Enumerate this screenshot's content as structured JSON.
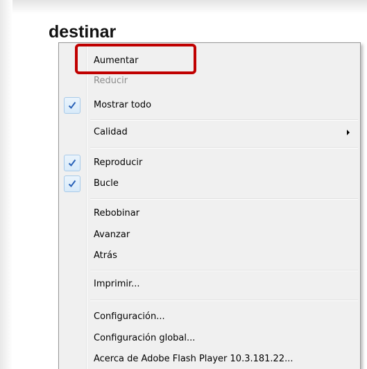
{
  "page": {
    "heading": "destinar"
  },
  "context_menu": {
    "items": [
      {
        "label": "Aumentar",
        "enabled": true,
        "checked": false,
        "submenu": false
      },
      {
        "label": "Reducir",
        "enabled": false,
        "checked": false,
        "submenu": false
      },
      {
        "label": "Mostrar todo",
        "enabled": true,
        "checked": true,
        "submenu": false
      },
      {
        "label": "Calidad",
        "enabled": true,
        "checked": false,
        "submenu": true
      },
      {
        "label": "Reproducir",
        "enabled": true,
        "checked": true,
        "submenu": false
      },
      {
        "label": "Bucle",
        "enabled": true,
        "checked": true,
        "submenu": false
      },
      {
        "label": "Rebobinar",
        "enabled": true,
        "checked": false,
        "submenu": false
      },
      {
        "label": "Avanzar",
        "enabled": true,
        "checked": false,
        "submenu": false
      },
      {
        "label": "Atrás",
        "enabled": true,
        "checked": false,
        "submenu": false
      },
      {
        "label": "Imprimir...",
        "enabled": true,
        "checked": false,
        "submenu": false
      },
      {
        "label": "Configuración...",
        "enabled": true,
        "checked": false,
        "submenu": false
      },
      {
        "label": "Configuración global...",
        "enabled": true,
        "checked": false,
        "submenu": false
      },
      {
        "label": "Acerca de Adobe Flash Player 10.3.181.22...",
        "enabled": true,
        "checked": false,
        "submenu": false
      }
    ],
    "check_icon": "checkmark-icon",
    "submenu_icon": "submenu-arrow-icon"
  },
  "annotation": {
    "highlight_color": "#c00000",
    "highlighted_item": "Aumentar"
  },
  "colors": {
    "menu_background": "#f0f0f0",
    "menu_border": "#979797",
    "check_color": "#2a62b8",
    "disabled_text": "#8d8d8d"
  }
}
